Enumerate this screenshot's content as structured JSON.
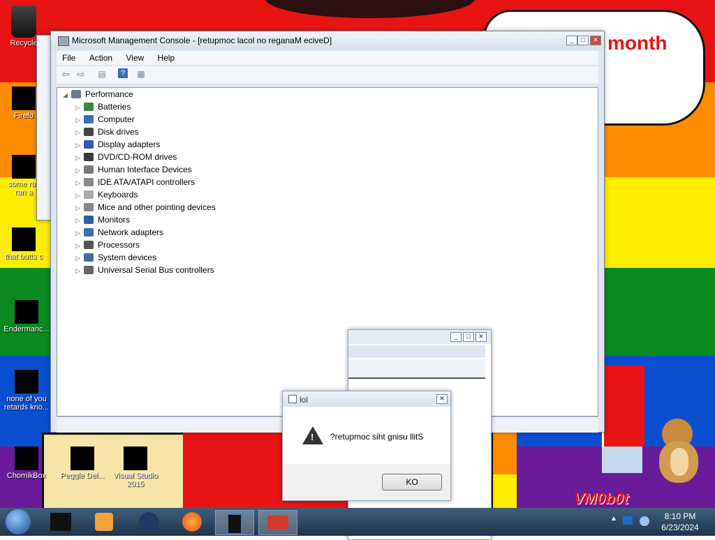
{
  "desktop": {
    "icons": [
      {
        "label": "Recycle"
      },
      {
        "label": "Firefo"
      },
      {
        "label": "some rus ran a"
      },
      {
        "label": "that butts c"
      },
      {
        "label": "Endermanc..."
      },
      {
        "label": "none of you retards kno..."
      },
      {
        "label": "ChomikBox"
      },
      {
        "label": "Peggle Del..."
      },
      {
        "label": "Visual Studio 2015"
      }
    ],
    "banner_text": "month",
    "banner_text_2": "m",
    "watermark": "VM0b0t"
  },
  "mmc": {
    "title": "Microsoft Management Console - [retupmoc lacol no reganaM eciveD]",
    "menu": [
      "File",
      "Action",
      "View",
      "Help"
    ],
    "toolbar_icons": [
      "back-icon",
      "forward-icon",
      "show-hide-tree-icon",
      "help-icon",
      "properties-icon"
    ],
    "root": "Performance",
    "nodes": [
      {
        "label": "Batteries",
        "icon": "battery-icon"
      },
      {
        "label": "Computer",
        "icon": "computer-icon"
      },
      {
        "label": "Disk drives",
        "icon": "disk-drive-icon"
      },
      {
        "label": "Display adapters",
        "icon": "display-adapter-icon"
      },
      {
        "label": "DVD/CD-ROM drives",
        "icon": "dvd-drive-icon"
      },
      {
        "label": "Human Interface Devices",
        "icon": "hid-icon"
      },
      {
        "label": "IDE ATA/ATAPI controllers",
        "icon": "ide-controller-icon"
      },
      {
        "label": "Keyboards",
        "icon": "keyboard-icon"
      },
      {
        "label": "Mice and other pointing devices",
        "icon": "mouse-icon"
      },
      {
        "label": "Monitors",
        "icon": "monitor-icon"
      },
      {
        "label": "Network adapters",
        "icon": "network-adapter-icon"
      },
      {
        "label": "Processors",
        "icon": "processor-icon"
      },
      {
        "label": "System devices",
        "icon": "system-devices-icon"
      },
      {
        "label": "Universal Serial Bus controllers",
        "icon": "usb-icon"
      }
    ]
  },
  "dialog": {
    "title": "lol",
    "message": "?retupmoc siht gnisu llitS",
    "button": "KO"
  },
  "taskbar": {
    "time": "8:10 PM",
    "date": "6/23/2024",
    "items": [
      "start-orb",
      "explorer",
      "media-player",
      "windows-media",
      "firefox",
      "device-window",
      "toolbox"
    ]
  },
  "colors": {
    "red": "#e81414",
    "orange": "#ff8c00",
    "yellow": "#ffee00",
    "green": "#0a8a1e",
    "blue": "#0b4fd1",
    "purple": "#6a1b9a"
  }
}
